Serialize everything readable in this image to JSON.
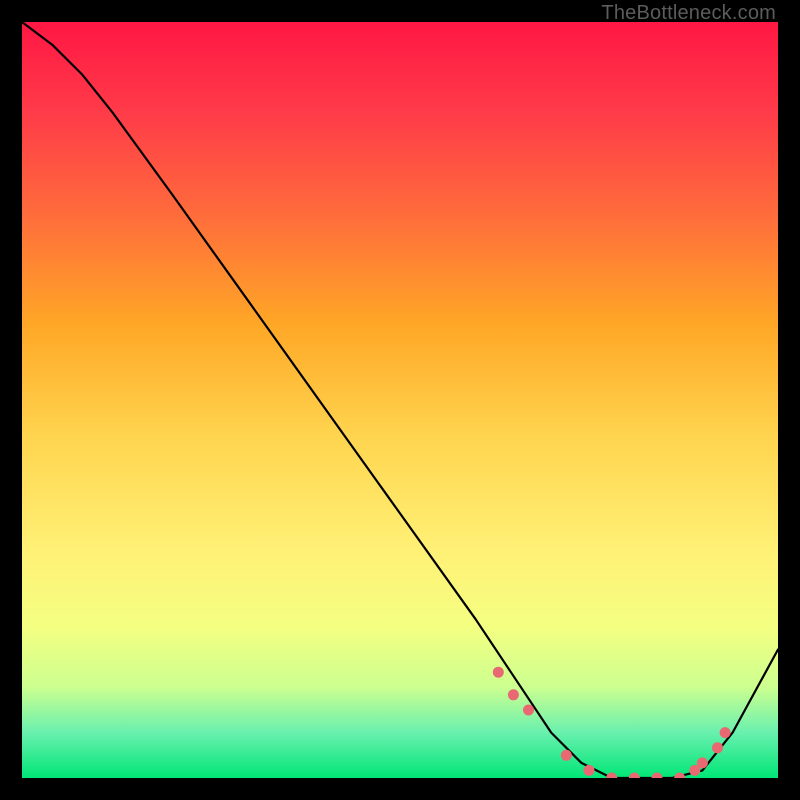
{
  "watermark": "TheBottleneck.com",
  "colors": {
    "black": "#000000",
    "line": "#000000",
    "dot": "#e86971",
    "gradient_stops": [
      {
        "offset": 0.0,
        "color": "#ff1744"
      },
      {
        "offset": 0.12,
        "color": "#ff3b49"
      },
      {
        "offset": 0.25,
        "color": "#ff6a3c"
      },
      {
        "offset": 0.4,
        "color": "#ffa726"
      },
      {
        "offset": 0.55,
        "color": "#ffd54f"
      },
      {
        "offset": 0.7,
        "color": "#fff176"
      },
      {
        "offset": 0.8,
        "color": "#f4ff81"
      },
      {
        "offset": 0.88,
        "color": "#ccff90"
      },
      {
        "offset": 0.94,
        "color": "#69f0ae"
      },
      {
        "offset": 1.0,
        "color": "#00e676"
      }
    ]
  },
  "chart_data": {
    "type": "line",
    "title": "",
    "xlabel": "",
    "ylabel": "",
    "xlim": [
      0,
      100
    ],
    "ylim": [
      0,
      100
    ],
    "series": [
      {
        "name": "curve",
        "x": [
          0,
          4,
          8,
          12,
          20,
          30,
          40,
          50,
          60,
          66,
          70,
          74,
          78,
          82,
          86,
          90,
          94,
          100
        ],
        "y": [
          100,
          97,
          93,
          88,
          77,
          63,
          49,
          35,
          21,
          12,
          6,
          2,
          0,
          0,
          0,
          1,
          6,
          17
        ]
      }
    ],
    "markers": {
      "name": "highlight-points",
      "x": [
        63,
        65,
        67,
        72,
        75,
        78,
        81,
        84,
        87,
        89,
        90,
        92,
        93
      ],
      "y": [
        14,
        11,
        9,
        3,
        1,
        0,
        0,
        0,
        0,
        1,
        2,
        4,
        6
      ]
    }
  }
}
